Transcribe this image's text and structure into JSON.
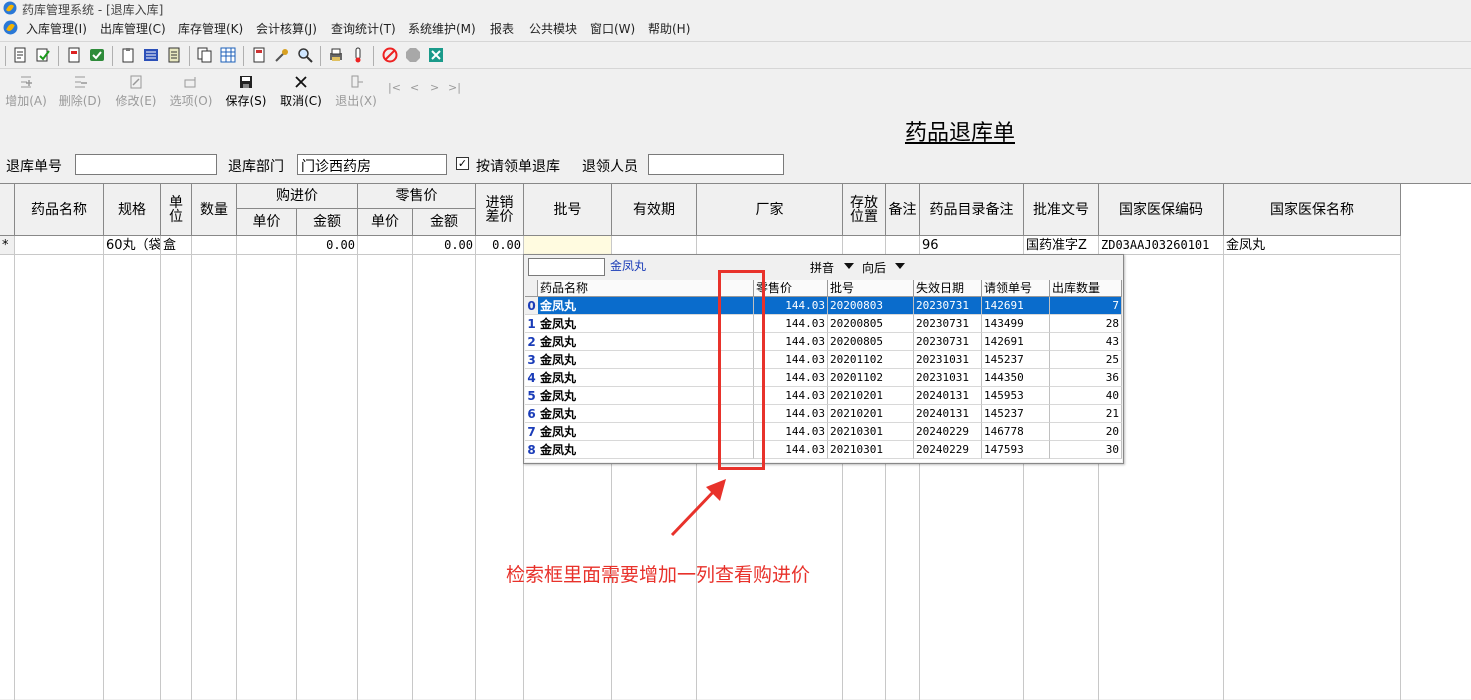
{
  "window": {
    "title": "药库管理系统 - [退库入库]"
  },
  "menu": [
    "入库管理(I)",
    "出库管理(C)",
    "库存管理(K)",
    "会计核算(J)",
    "查询统计(T)",
    "系统维护(M)",
    "报表",
    "公共模块",
    "窗口(W)",
    "帮助(H)"
  ],
  "commands": [
    {
      "label": "增加(A)",
      "icon": "add-icon",
      "enabled": false
    },
    {
      "label": "删除(D)",
      "icon": "delete-icon",
      "enabled": false
    },
    {
      "label": "修改(E)",
      "icon": "edit-icon",
      "enabled": false
    },
    {
      "label": "选项(O)",
      "icon": "options-icon",
      "enabled": false
    },
    {
      "label": "保存(S)",
      "icon": "save-icon",
      "enabled": true
    },
    {
      "label": "取消(C)",
      "icon": "cancel-icon",
      "enabled": true
    },
    {
      "label": "退出(X)",
      "icon": "exit-icon",
      "enabled": false
    }
  ],
  "nav_arrows": [
    "|<",
    "<",
    ">",
    ">|"
  ],
  "form": {
    "title": "药品退库单",
    "return_no_label": "退库单号",
    "return_no_value": "",
    "dept_label": "退库部门",
    "dept_value": "门诊西药房",
    "by_request_label": "按请领单退库",
    "by_request_checked": true,
    "by_request_mark": "✓",
    "returner_label": "退领人员",
    "returner_value": ""
  },
  "grid": {
    "headers": {
      "drug_name": "药品名称",
      "spec": "规格",
      "unit": "单位",
      "qty": "数量",
      "purchase": "购进价",
      "retail": "零售价",
      "unit_price": "单价",
      "amount": "金额",
      "price_diff": "进销差价",
      "batch": "批号",
      "expiry": "有效期",
      "vendor": "厂家",
      "location": "存放位置",
      "remark": "备注",
      "catalog_remark": "药品目录备注",
      "approval_no": "批准文号",
      "insurance_code": "国家医保编码",
      "insurance_name": "国家医保名称"
    },
    "row": {
      "marker": "*",
      "drug_name": "",
      "spec": "60丸（袋",
      "unit": "盒",
      "qty": "",
      "purchase_price": "",
      "purchase_amount": "0.00",
      "retail_price": "",
      "retail_amount": "0.00",
      "price_diff": "0.00",
      "batch": "",
      "expiry": "",
      "vendor": "",
      "location": "",
      "remark": "",
      "catalog_remark": "96",
      "approval_no": "国药准字Z",
      "insurance_code": "ZD03AAJ03260101",
      "insurance_name": "金凤丸"
    }
  },
  "dropdown": {
    "search_value": "",
    "query": "金凤丸",
    "mode": "拼音",
    "direction": "向后",
    "columns": [
      "药品名称",
      "零售价",
      "批号",
      "失效日期",
      "请领单号",
      "出库数量"
    ],
    "rows": [
      {
        "idx": "0",
        "name": "金凤丸",
        "price": "144.03",
        "batch": "20200803",
        "expiry": "20230731",
        "req": "142691",
        "qty": "7"
      },
      {
        "idx": "1",
        "name": "金凤丸",
        "price": "144.03",
        "batch": "20200805",
        "expiry": "20230731",
        "req": "143499",
        "qty": "28"
      },
      {
        "idx": "2",
        "name": "金凤丸",
        "price": "144.03",
        "batch": "20200805",
        "expiry": "20230731",
        "req": "142691",
        "qty": "43"
      },
      {
        "idx": "3",
        "name": "金凤丸",
        "price": "144.03",
        "batch": "20201102",
        "expiry": "20231031",
        "req": "145237",
        "qty": "25"
      },
      {
        "idx": "4",
        "name": "金凤丸",
        "price": "144.03",
        "batch": "20201102",
        "expiry": "20231031",
        "req": "144350",
        "qty": "36"
      },
      {
        "idx": "5",
        "name": "金凤丸",
        "price": "144.03",
        "batch": "20210201",
        "expiry": "20240131",
        "req": "145953",
        "qty": "40"
      },
      {
        "idx": "6",
        "name": "金凤丸",
        "price": "144.03",
        "batch": "20210201",
        "expiry": "20240131",
        "req": "145237",
        "qty": "21"
      },
      {
        "idx": "7",
        "name": "金凤丸",
        "price": "144.03",
        "batch": "20210301",
        "expiry": "20240229",
        "req": "146778",
        "qty": "20"
      },
      {
        "idx": "8",
        "name": "金凤丸",
        "price": "144.03",
        "batch": "20210301",
        "expiry": "20240229",
        "req": "147593",
        "qty": "30"
      }
    ],
    "selected_index": 0
  },
  "annotation": {
    "text": "检索框里面需要增加一列查看购进价",
    "color": "#e8322b"
  },
  "colors": {
    "selection": "#0a6ccc",
    "annotation": "#e8322b",
    "index_text": "#1a3cb8"
  }
}
